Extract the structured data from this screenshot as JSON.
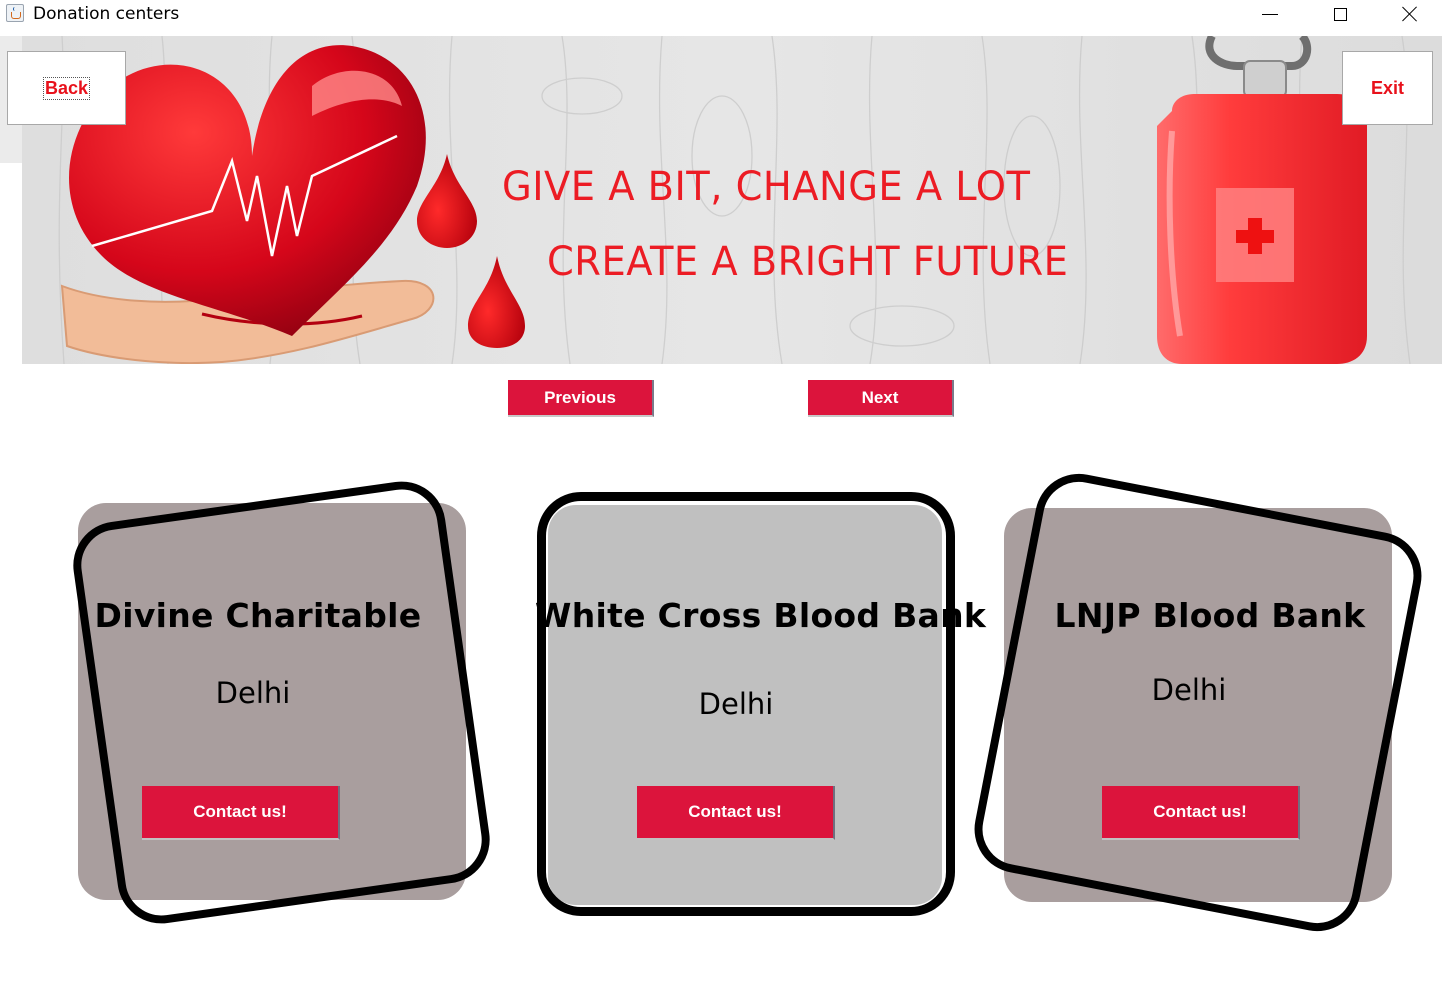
{
  "window": {
    "title": "Donation centers",
    "controls": [
      "minimize",
      "maximize",
      "close"
    ]
  },
  "banner": {
    "slogan_line_1": "GIVE A BIT, CHANGE A LOT",
    "slogan_line_2": "CREATE A BRIGHT FUTURE",
    "slogan_color": "#ec1c24"
  },
  "header": {
    "back_label": "Back",
    "exit_label": "Exit"
  },
  "pager": {
    "previous_label": "Previous",
    "next_label": "Next"
  },
  "cards": [
    {
      "name": "Divine Charitable",
      "city": "Delhi",
      "button_label": "Contact us!"
    },
    {
      "name": "White Cross Blood Bank",
      "city": "Delhi",
      "button_label": "Contact us!"
    },
    {
      "name": "LNJP Blood Bank",
      "city": "Delhi",
      "button_label": "Contact us!"
    }
  ],
  "colors": {
    "accent": "#dc143c",
    "card_side": "#a99e9e",
    "card_center": "#c0c0c0"
  }
}
